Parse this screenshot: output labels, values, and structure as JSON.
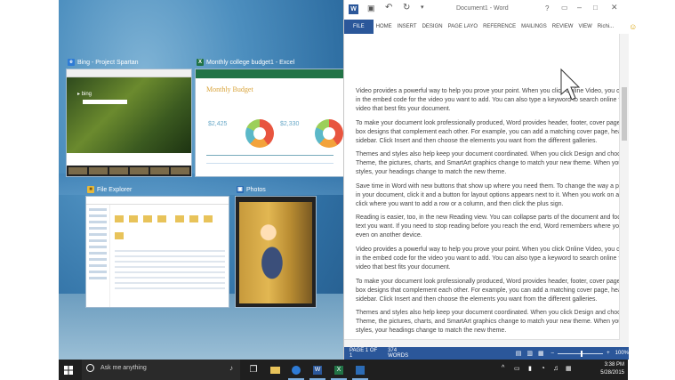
{
  "windows": {
    "bing": {
      "title": "Bing - Project Spartan"
    },
    "excel": {
      "title": "Monthly college budget1 - Excel",
      "sheet_title": "Monthly Budget",
      "income_value": "$2,425",
      "expense_value": "$2,330"
    },
    "explorer": {
      "title": "File Explorer"
    },
    "photos": {
      "title": "Photos"
    }
  },
  "word": {
    "title": "Document1 - Word",
    "user": "Richi...",
    "tabs": [
      "FILE",
      "HOME",
      "INSERT",
      "DESIGN",
      "PAGE LAYO",
      "REFERENCE",
      "MAILINGS",
      "REVIEW",
      "VIEW"
    ],
    "paragraphs": [
      "Video provides a powerful way to help you prove your point. When you click Online Video, you can paste in the embed code for the video you want to add. You can also type a keyword to search online for the video that best fits your document.",
      "To make your document look professionally produced, Word provides header, footer, cover page, and text box designs that complement each other. For example, you can add a matching cover page, header, and sidebar. Click Insert and then choose the elements you want from the different galleries.",
      "Themes and styles also help keep your document coordinated. When you click Design and choose a new Theme, the pictures, charts, and SmartArt graphics change to match your new theme. When you apply styles, your headings change to match the new theme.",
      "Save time in Word with new buttons that show up where you need them. To change the way a picture fits in your document, click it and a button for layout options appears next to it. When you work on a table, click where you want to add a row or a column, and then click the plus sign.",
      "Reading is easier, too, in the new Reading view. You can collapse parts of the document and focus on the text you want. If you need to stop reading before you reach the end, Word remembers where you left off - even on another device.",
      "Video provides a powerful way to help you prove your point. When you click Online Video, you can paste in the embed code for the video you want to add. You can also type a keyword to search online for the video that best fits your document.",
      "To make your document look professionally produced, Word provides header, footer, cover page, and text box designs that complement each other. For example, you can add a matching cover page, header, and sidebar. Click Insert and then choose the elements you want from the different galleries.",
      "Themes and styles also help keep your document coordinated. When you click Design and choose a new Theme, the pictures, charts, and SmartArt graphics change to match your new theme. When you apply styles, your headings change to match the new theme."
    ],
    "status": {
      "page": "PAGE 1 OF 1",
      "words": "374 WORDS",
      "zoom": "100%"
    }
  },
  "taskbar": {
    "search_placeholder": "Ask me anything",
    "time": "3:38 PM",
    "date": "5/28/2015"
  }
}
